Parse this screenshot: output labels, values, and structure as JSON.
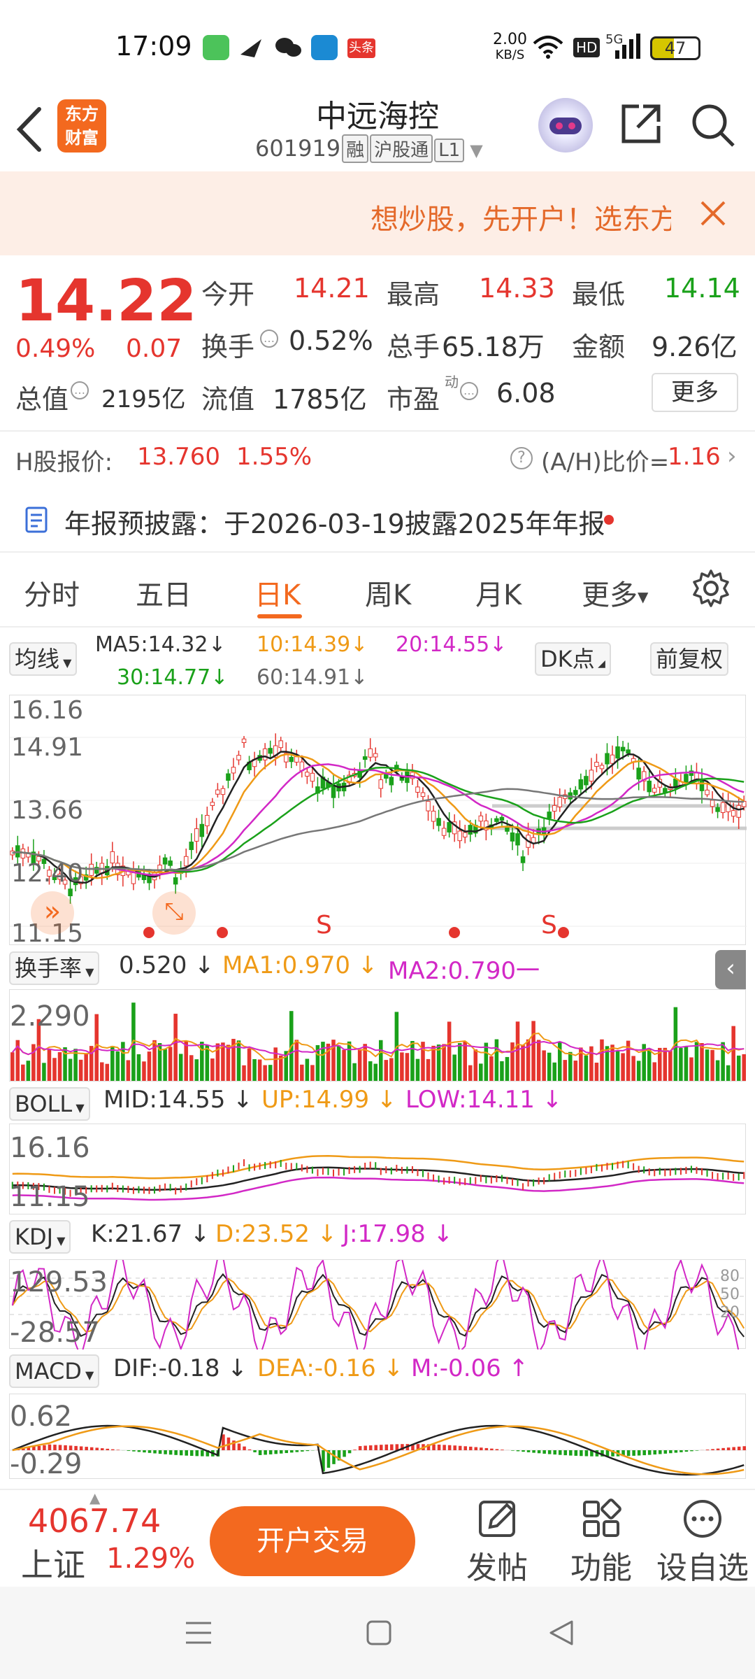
{
  "status_bar": {
    "time": "17:09",
    "net_speed": "2.00",
    "net_unit": "KB/S",
    "toutiao": "头条",
    "hd": "HD",
    "fiveg": "5G",
    "battery": "47"
  },
  "header": {
    "title": "中远海控",
    "code": "601919",
    "tags": [
      "融",
      "沪股通",
      "L1"
    ],
    "logo_text": [
      "东方",
      "财富"
    ]
  },
  "banner": {
    "text": "想炒股，先开户！选东方"
  },
  "quote": {
    "price": "14.22",
    "change_pct": "0.49%",
    "change": "0.07",
    "open_label": "今开",
    "open": "14.21",
    "high_label": "最高",
    "high": "14.33",
    "low_label": "最低",
    "low": "14.14",
    "turnover_label": "换手",
    "turnover": "0.52%",
    "volume_label": "总手",
    "volume": "65.18万",
    "amount_label": "金额",
    "amount": "9.26亿",
    "mcap_label": "总值",
    "mcap": "2195亿",
    "float_label": "流值",
    "float": "1785亿",
    "pe_label": "市盈",
    "pe_sup": "动",
    "pe": "6.08",
    "more": "更多"
  },
  "hshare": {
    "label": "H股报价:",
    "price": "13.760",
    "pct": "1.55%",
    "ratio_label": "(A/H)比价=",
    "ratio": "1.16"
  },
  "notice": {
    "text": "年报预披露：于2026-03-19披露2025年年报"
  },
  "tabs": [
    "分时",
    "五日",
    "日K",
    "周K",
    "月K",
    "更多"
  ],
  "active_tab": "日K",
  "ma_bar": {
    "selector": "均线",
    "ma5": "MA5:14.32",
    "ma10": "10:14.39",
    "ma20": "20:14.55",
    "ma30": "30:14.77",
    "ma60": "60:14.91",
    "dk": "DK点",
    "fq": "前复权"
  },
  "main_axis": [
    "16.16",
    "14.91",
    "13.66",
    "12.40",
    "11.15"
  ],
  "signals": [
    "S",
    "S"
  ],
  "turnover_bar": {
    "selector": "换手率",
    "value": "0.520",
    "ma1": "MA1:0.970",
    "ma2": "MA2:0.790",
    "axis": "2.290"
  },
  "boll_bar": {
    "selector": "BOLL",
    "mid": "MID:14.55",
    "up": "UP:14.99",
    "low": "LOW:14.11",
    "axis_top": "16.16",
    "axis_bottom": "11.15"
  },
  "kdj_bar": {
    "selector": "KDJ",
    "k": "K:21.67",
    "d": "D:23.52",
    "j": "J:17.98",
    "axis_top": "129.53",
    "axis_bottom": "-28.57",
    "levels": [
      "80",
      "50",
      "20"
    ]
  },
  "macd_bar": {
    "selector": "MACD",
    "dif": "DIF:-0.18",
    "dea": "DEA:-0.16",
    "m": "M:-0.06",
    "axis_top": "0.62",
    "axis_bottom": "-0.29"
  },
  "bottom": {
    "index_value": "4067.74",
    "index_name": "上证",
    "index_pct": "1.29%",
    "open_btn": "开户交易",
    "post": "发帖",
    "func": "功能",
    "fav": "设自选"
  },
  "colors": {
    "up": "#e5352e",
    "down": "#1aa11a",
    "accent": "#f3691f",
    "ma10": "#ef9a16",
    "ma20": "#d228c6"
  }
}
